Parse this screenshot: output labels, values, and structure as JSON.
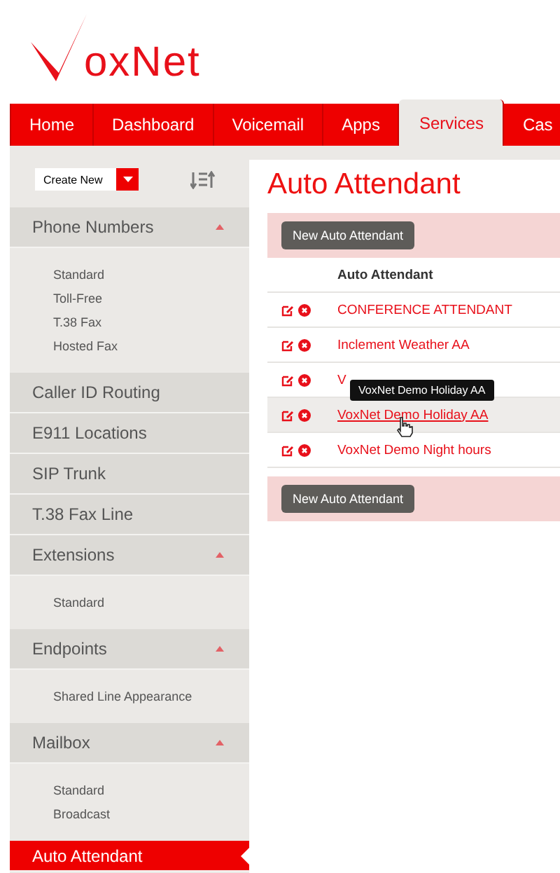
{
  "logo": {
    "text": "oxNet"
  },
  "nav": {
    "tabs": [
      {
        "label": "Home",
        "selected": false
      },
      {
        "label": "Dashboard",
        "selected": false
      },
      {
        "label": "Voicemail",
        "selected": false
      },
      {
        "label": "Apps",
        "selected": false
      },
      {
        "label": "Services",
        "selected": true
      },
      {
        "label": "Cas",
        "selected": false
      }
    ]
  },
  "sidebar": {
    "create_select": {
      "value": "Create New"
    },
    "items": [
      {
        "kind": "group",
        "label": "Phone Numbers",
        "expanded": true,
        "selected": false,
        "children": [
          {
            "label": "Standard"
          },
          {
            "label": "Toll-Free"
          },
          {
            "label": "T.38 Fax"
          },
          {
            "label": "Hosted Fax"
          }
        ]
      },
      {
        "kind": "link",
        "label": "Caller ID Routing",
        "selected": false
      },
      {
        "kind": "link",
        "label": "E911 Locations",
        "selected": false
      },
      {
        "kind": "link",
        "label": "SIP Trunk",
        "selected": false
      },
      {
        "kind": "link",
        "label": "T.38 Fax Line",
        "selected": false
      },
      {
        "kind": "group",
        "label": "Extensions",
        "expanded": true,
        "selected": false,
        "children": [
          {
            "label": "Standard"
          }
        ]
      },
      {
        "kind": "group",
        "label": "Endpoints",
        "expanded": true,
        "selected": false,
        "children": [
          {
            "label": "Shared Line Appearance"
          }
        ]
      },
      {
        "kind": "group",
        "label": "Mailbox",
        "expanded": true,
        "selected": false,
        "children": [
          {
            "label": "Standard"
          },
          {
            "label": "Broadcast"
          }
        ]
      },
      {
        "kind": "link",
        "label": "Auto Attendant",
        "selected": true
      }
    ]
  },
  "content": {
    "title": "Auto Attendant",
    "top_button": "New Auto Attendant",
    "table": {
      "columns": [
        "Auto Attendant"
      ],
      "rows": [
        {
          "name": "CONFERENCE ATTENDANT",
          "hovered": false
        },
        {
          "name": "Inclement Weather AA",
          "hovered": false
        },
        {
          "name": "V",
          "hovered": false
        },
        {
          "name": "VoxNet Demo Holiday AA",
          "hovered": true
        },
        {
          "name": "VoxNet Demo Night hours",
          "hovered": false
        }
      ]
    },
    "tooltip": "VoxNet Demo Holiday AA",
    "bottom_button": "New Auto Attendant"
  }
}
